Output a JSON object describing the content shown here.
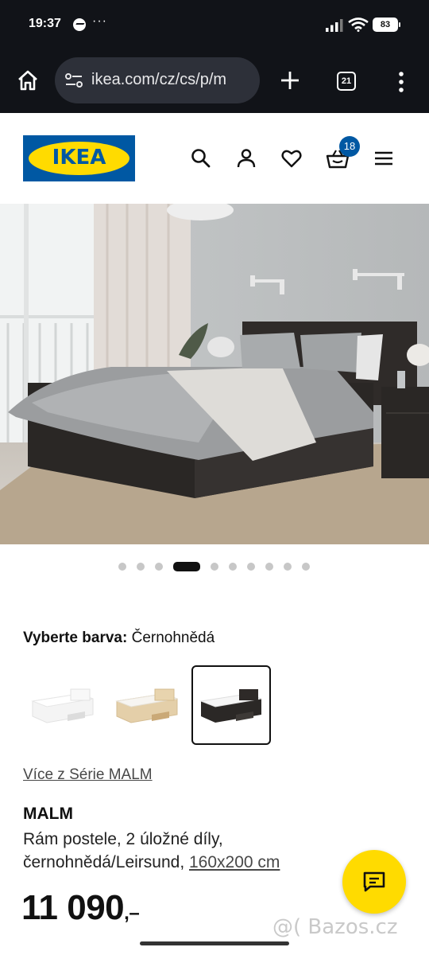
{
  "status_bar": {
    "time": "19:37",
    "dots": "···",
    "battery": "83",
    "icons": [
      "messenger-icon",
      "signal-icon",
      "wifi-icon",
      "battery-icon"
    ]
  },
  "browser": {
    "url": "ikea.com/cz/cs/p/m",
    "tab_count": "21",
    "icons": [
      "home-icon",
      "site-settings-icon",
      "new-tab-icon",
      "tabs-icon",
      "menu-dots-icon"
    ]
  },
  "header": {
    "logo_text": "IKEA",
    "basket_count": "18",
    "brand_blue": "#0058a3",
    "brand_yellow": "#ffdb00",
    "icons": [
      "search-icon",
      "profile-icon",
      "heart-icon",
      "basket-icon",
      "hamburger-icon"
    ]
  },
  "carousel": {
    "count": 10,
    "active_index": 3
  },
  "color_picker": {
    "label": "Vyberte barva:",
    "value": "Černohnědá",
    "swatches": [
      {
        "color": "white",
        "selected": false
      },
      {
        "color": "oak",
        "selected": false
      },
      {
        "color": "black-brown",
        "selected": true
      }
    ]
  },
  "series_link": "Více z Série MALM",
  "product": {
    "name": "MALM",
    "description_line1": "Rám postele, 2 úložné díly,",
    "description_line2": "černohnědá/Leirsund,",
    "size": "160x200 cm",
    "price": "11 090",
    "price_suffix": ",–"
  },
  "chat": {
    "icon": "chat-icon"
  },
  "watermark": "@( Bazos.cz"
}
